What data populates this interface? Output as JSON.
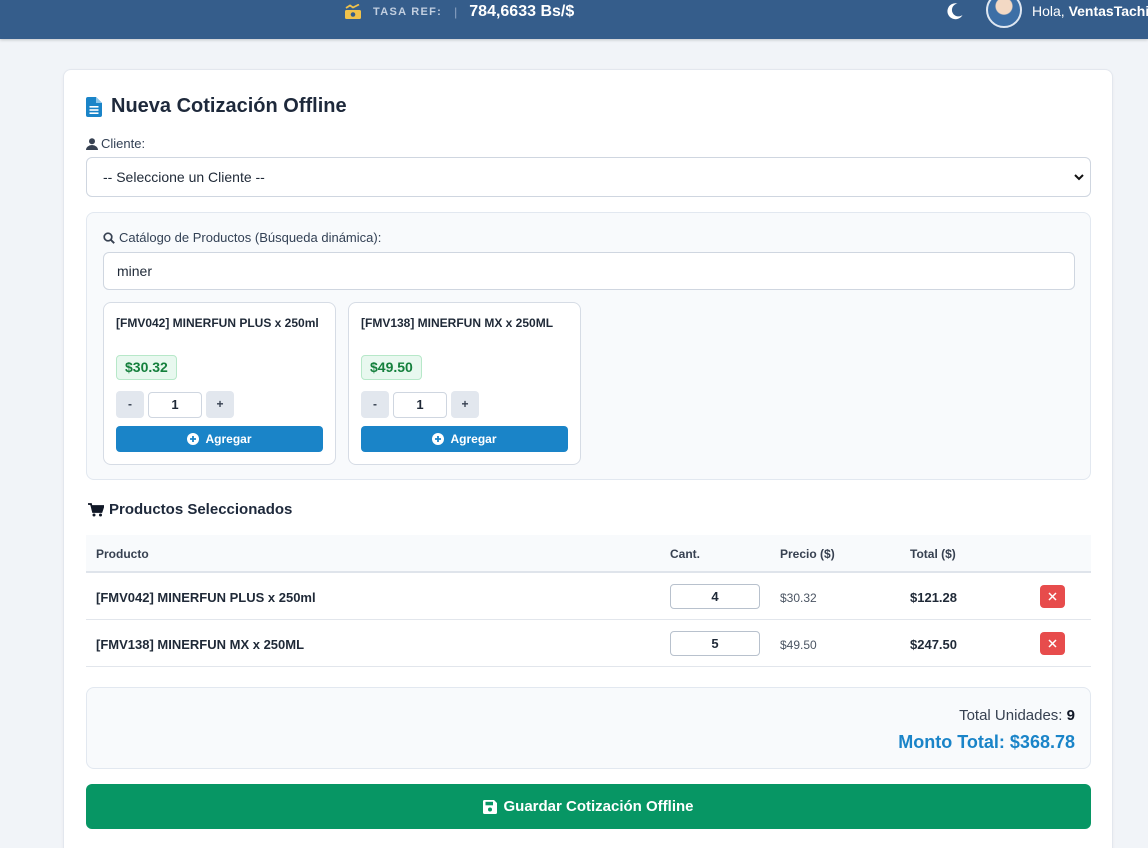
{
  "header": {
    "rate_label": "TASA REF:",
    "rate_separator": "|",
    "rate_value": "784,6633 Bs/$",
    "greeting": "Hola,",
    "username": "VentasTachira"
  },
  "form": {
    "title": "Nueva Cotización Offline",
    "client_label": "Cliente:",
    "client_select_value": "-- Seleccione un Cliente --"
  },
  "catalog": {
    "label": "Catálogo de Productos (Búsqueda dinámica):",
    "search_value": "miner",
    "products": [
      {
        "name": "[FMV042] MINERFUN PLUS x 250ml",
        "price": "$30.32",
        "qty": "1",
        "minus": "-",
        "plus": "+",
        "add_label": "Agregar"
      },
      {
        "name": "[FMV138] MINERFUN MX x 250ML",
        "price": "$49.50",
        "qty": "1",
        "minus": "-",
        "plus": "+",
        "add_label": "Agregar"
      }
    ]
  },
  "selected": {
    "title": "Productos Seleccionados",
    "columns": [
      "Producto",
      "Cant.",
      "Precio ($)",
      "Total ($)"
    ],
    "rows": [
      {
        "product": "[FMV042] MINERFUN PLUS x 250ml",
        "qty": "4",
        "price": "$30.32",
        "total": "$121.28"
      },
      {
        "product": "[FMV138] MINERFUN MX x 250ML",
        "qty": "5",
        "price": "$49.50",
        "total": "$247.50"
      }
    ]
  },
  "summary": {
    "units_label": "Total Unidades:",
    "units_value": "9",
    "total_label": "Monto Total:",
    "total_value": "$368.78"
  },
  "actions": {
    "save_label": "Guardar Cotización Offline"
  },
  "colors": {
    "topbar": "#355d8b",
    "primary": "#1a84c8",
    "success": "#079664",
    "danger": "#e74c4c"
  }
}
